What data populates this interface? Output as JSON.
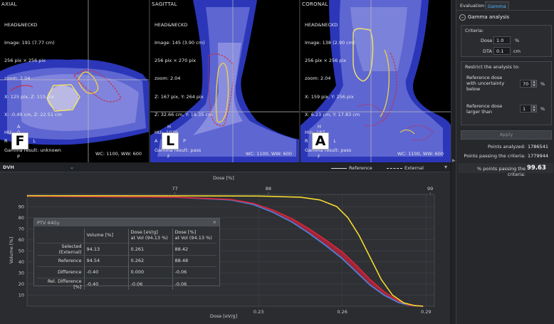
{
  "viewers": {
    "axial": {
      "title": "AXIAL",
      "info": [
        "HEAD&NECKD",
        "Image: 191 (7.77 cm)",
        "256 pix × 256 pix",
        "zoom: 2.04",
        "X: 125 pix, Z: 115 pix",
        "X: -0.49 cm, Z: 22.51 cm",
        "HU:   0",
        "Gamma result: unknown"
      ],
      "orient": {
        "big": "F",
        "top": "A",
        "bottom": "P",
        "left": "R",
        "right": "L"
      },
      "wcww": "WC: 1100, WW:  600"
    },
    "sagittal": {
      "title": "SAGITTAL",
      "info": [
        "HEAD&NECKD",
        "Image: 145 (3.90 cm)",
        "256 pix × 270 pix",
        "zoom: 2.04",
        "Z: 167 pix, Y: 264 pix",
        "Z: 32.66 cm, Y: 18.35 cm",
        "HU:  1029",
        "Gamma result: pass"
      ],
      "orient": {
        "big": "L",
        "top": "H",
        "bottom": "F",
        "left": "A",
        "right": "P"
      },
      "wcww": "WC: 1100, WW:  600"
    },
    "coronal": {
      "title": "CORONAL",
      "info": [
        "HEAD&NECKD",
        "Image: 138 (2.90 cm)",
        "256 pix × 256 pix",
        "zoom: 2.04",
        "X: 159 pix, Y: 256 pix",
        "X: 6.23 cm, Y: 17.83 cm",
        "HU:  187",
        "Gamma result: pass"
      ],
      "orient": {
        "big": "A",
        "top": "H",
        "bottom": "F",
        "left": "R",
        "right": "L"
      },
      "wcww": "WC: 1100, WW:  600"
    }
  },
  "dvh": {
    "selector": "DVH",
    "legend_reference": "Reference",
    "legend_external": "External"
  },
  "stats": {
    "caption": "PTV 44Gy",
    "close": "×",
    "headers": [
      "Volume [%]",
      "Dose [eV/g]\nat Vol (94.13 %)",
      "Dose [%]\nat Vol (94.13 %)"
    ],
    "rows": [
      {
        "label": "Selected (External)",
        "v": [
          "94.13",
          "0.261",
          "88.42"
        ]
      },
      {
        "label": "Reference",
        "v": [
          "94.54",
          "0.262",
          "88.48"
        ]
      },
      {
        "label": "Difference",
        "v": [
          "-0.40",
          "0.000",
          "-0.06"
        ]
      },
      {
        "label": "Rel. Difference [%]",
        "v": [
          "-0.40",
          "-0.06",
          "-0.06"
        ]
      }
    ]
  },
  "chart_data": {
    "type": "line",
    "title": "",
    "xlabel": "Dose [eV/g]",
    "x2label": "Dose [%]",
    "ylabel": "Volume [%]",
    "xlim": [
      0.147,
      0.293
    ],
    "ylim": [
      0,
      100
    ],
    "yticks": [
      10,
      20,
      30,
      40,
      50,
      60,
      70,
      80,
      90
    ],
    "xticks": [
      {
        "v": 0.23,
        "label": "0.23"
      },
      {
        "v": 0.26,
        "label": "0.26"
      },
      {
        "v": 0.29,
        "label": "0.29"
      }
    ],
    "x2ticks": [
      {
        "v": 0.2,
        "label": "77"
      },
      {
        "v": 0.2335,
        "label": "88"
      },
      {
        "v": 0.2915,
        "label": "99"
      }
    ],
    "grid": true,
    "series": [
      {
        "style": "blue",
        "color": "#4f7fd8",
        "x": [
          0.147,
          0.17,
          0.2,
          0.22,
          0.228,
          0.235,
          0.242,
          0.248,
          0.254,
          0.26,
          0.265,
          0.27,
          0.275,
          0.28,
          0.284,
          0.289
        ],
        "y": [
          99.5,
          99,
          98.5,
          96,
          92,
          85,
          76,
          66,
          55,
          43,
          31,
          19,
          10,
          3.5,
          0.8,
          0
        ]
      },
      {
        "style": "red",
        "color": "#d0263a",
        "x": [
          0.147,
          0.17,
          0.2,
          0.22,
          0.228,
          0.235,
          0.242,
          0.248,
          0.254,
          0.26,
          0.265,
          0.27,
          0.275,
          0.28,
          0.284,
          0.289
        ],
        "y": [
          99.5,
          99,
          98.5,
          96.5,
          93,
          87,
          79,
          70,
          60,
          49,
          37,
          24,
          13,
          5,
          1,
          0
        ]
      },
      {
        "style": "yellow",
        "color": "#f0d010",
        "x": [
          0.147,
          0.2,
          0.23,
          0.245,
          0.252,
          0.258,
          0.262,
          0.266,
          0.27,
          0.274,
          0.278,
          0.282,
          0.286,
          0.289
        ],
        "y": [
          99.8,
          99.7,
          99.5,
          98.5,
          96,
          90,
          80,
          64,
          44,
          24,
          10,
          3,
          0.5,
          0
        ]
      }
    ]
  },
  "rpanel": {
    "tabs": [
      "Evaluation",
      "Gamma"
    ],
    "gamma_title": "Gamma analysis",
    "criteria_title": "Criteria:",
    "dose_label": "Dose",
    "dose_value": "1.0",
    "dose_unit": "%",
    "dta_label": "DTA",
    "dta_value": "0.1",
    "dta_unit": "cm",
    "restrict_title": "Restrict the analysis to:",
    "ref_unc_label_1": "Reference dose",
    "ref_unc_label_2": "with uncertainty",
    "ref_unc_label_3": "below",
    "ref_unc_value": "70",
    "ref_unc_unit": "%",
    "ref_larger_label_1": "Reference dose",
    "ref_larger_label_2": "larger than",
    "ref_larger_value": "1",
    "ref_larger_unit": "%",
    "apply": "Apply",
    "points_analyzed_label": "Points analyzed:",
    "points_analyzed": "1786541",
    "points_passing_label": "Points passing the criteria:",
    "points_passing": "1779944",
    "pct_label": "% points passing the criteria:",
    "pct_value": "99.63"
  }
}
